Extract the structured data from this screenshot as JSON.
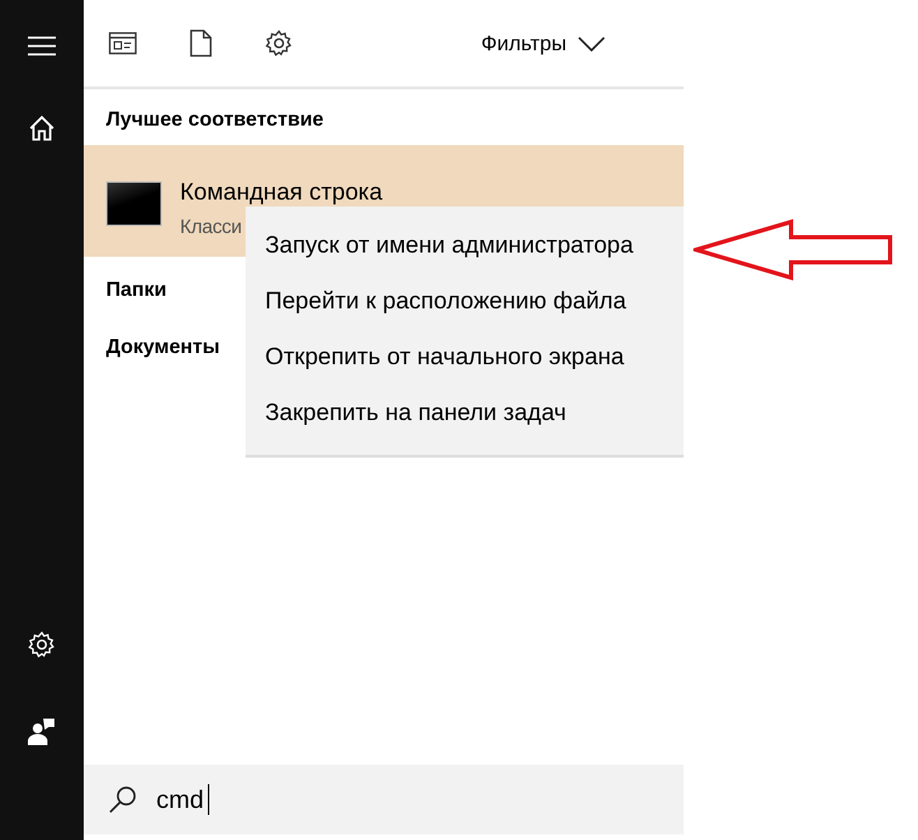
{
  "toolbar": {
    "filters_label": "Фильтры"
  },
  "best_match": {
    "heading": "Лучшее соответствие",
    "result": {
      "title": "Командная строка",
      "subtitle": "Класси",
      "selected": true
    }
  },
  "groups": [
    "Папки",
    "Документы"
  ],
  "context_menu": {
    "items": [
      {
        "label": "Запуск от имени администратора"
      },
      {
        "label": "Перейти к расположению файла"
      },
      {
        "label": "Открепить от начального экрана"
      },
      {
        "label": "Закрепить на панели задач"
      }
    ]
  },
  "search": {
    "value": "cmd"
  }
}
